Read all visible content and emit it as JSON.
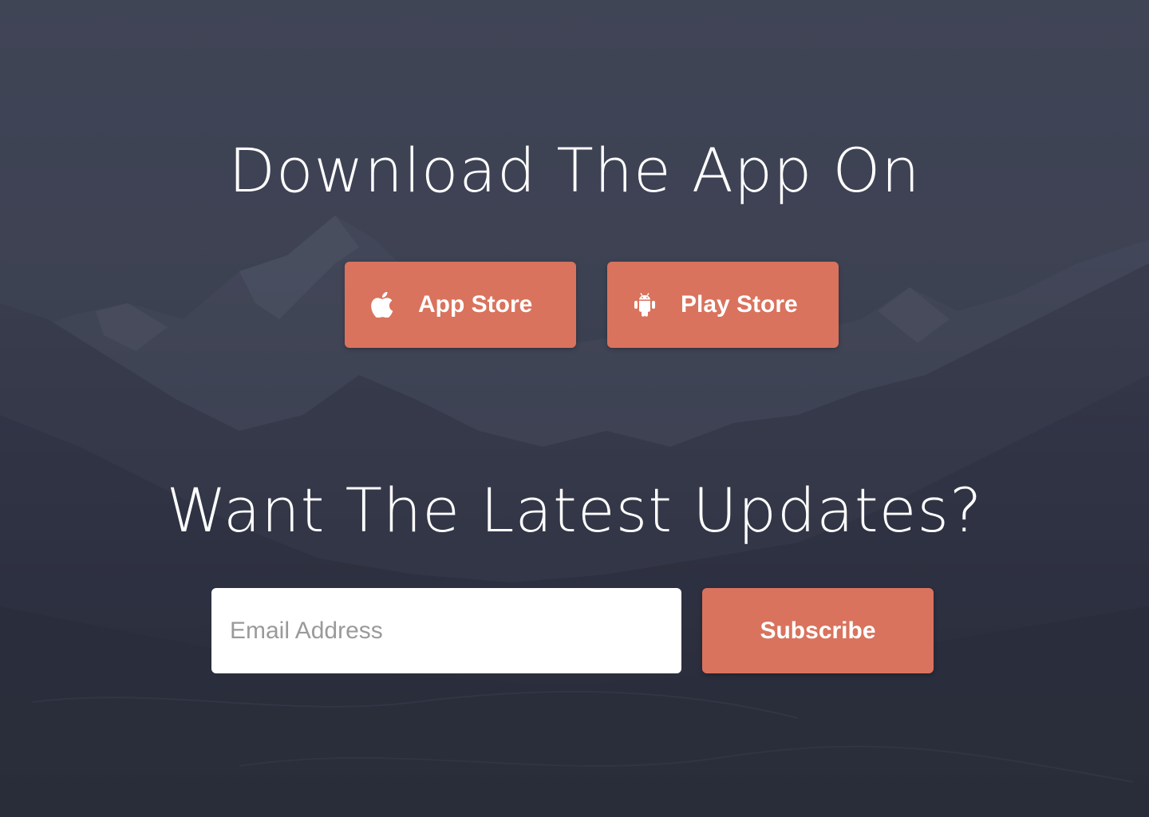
{
  "hero": {
    "download_title": "Download The App On",
    "updates_title": "Want The Latest Updates?"
  },
  "buttons": {
    "app_store": {
      "label": "App Store",
      "icon": "apple-icon"
    },
    "play_store": {
      "label": "Play Store",
      "icon": "android-icon"
    },
    "subscribe": {
      "label": "Subscribe"
    }
  },
  "subscribe_form": {
    "email_placeholder": "Email Address",
    "email_value": ""
  },
  "colors": {
    "accent": "#d9735d",
    "overlay": "#3b4052",
    "text": "#ffffff"
  }
}
